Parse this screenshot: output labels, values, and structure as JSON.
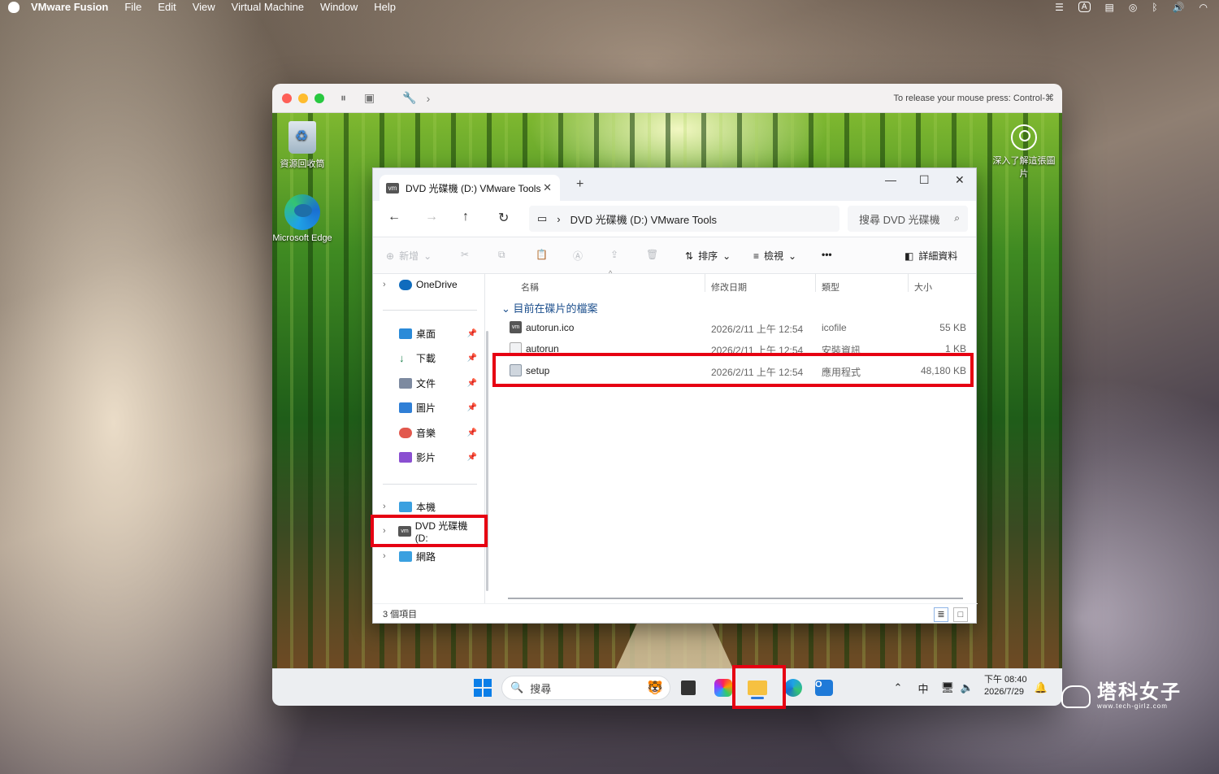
{
  "mac_menubar": {
    "app_name": "VMware Fusion",
    "items": [
      "File",
      "Edit",
      "View",
      "Virtual Machine",
      "Window",
      "Help"
    ],
    "input_indicator": "A"
  },
  "vm_window": {
    "hint": "To release your mouse press: Control-⌘"
  },
  "desktop": {
    "recycle_bin": "資源回收筒",
    "edge": "Microsoft Edge",
    "learn": "深入了解這張圖片"
  },
  "explorer": {
    "tab_title": "DVD 光碟機 (D:) VMware Tools",
    "address": "DVD 光碟機 (D:) VMware Tools",
    "search_placeholder": "搜尋 DVD 光碟機",
    "toolbar": {
      "new": "新增",
      "sort": "排序",
      "view": "檢視",
      "details": "詳細資料"
    },
    "sidebar": {
      "onedrive": "OneDrive",
      "desktop": "桌面",
      "downloads": "下載",
      "documents": "文件",
      "pictures": "圖片",
      "music": "音樂",
      "videos": "影片",
      "this_pc": "本機",
      "dvd": "DVD 光碟機 (D:",
      "network": "網路"
    },
    "columns": {
      "name": "名稱",
      "date": "修改日期",
      "type": "類型",
      "size": "大小"
    },
    "group_label": "目前在碟片的檔案",
    "files": [
      {
        "name": "autorun.ico",
        "date": "2026/2/11 上午 12:54",
        "type": "icofile",
        "size": "55 KB"
      },
      {
        "name": "autorun",
        "date": "2026/2/11 上午 12:54",
        "type": "安裝資訊",
        "size": "1 KB"
      },
      {
        "name": "setup",
        "date": "2026/2/11 上午 12:54",
        "type": "應用程式",
        "size": "48,180 KB"
      }
    ],
    "status": "3 個項目"
  },
  "taskbar": {
    "search_placeholder": "搜尋",
    "ime": "中",
    "time": "下午 08:40",
    "date": "2026/7/29"
  },
  "watermark": {
    "title": "塔科女子",
    "url": "www.tech-girlz.com"
  },
  "colors": {
    "highlight_red": "#e60012",
    "accent_blue": "#0b7ee8"
  }
}
